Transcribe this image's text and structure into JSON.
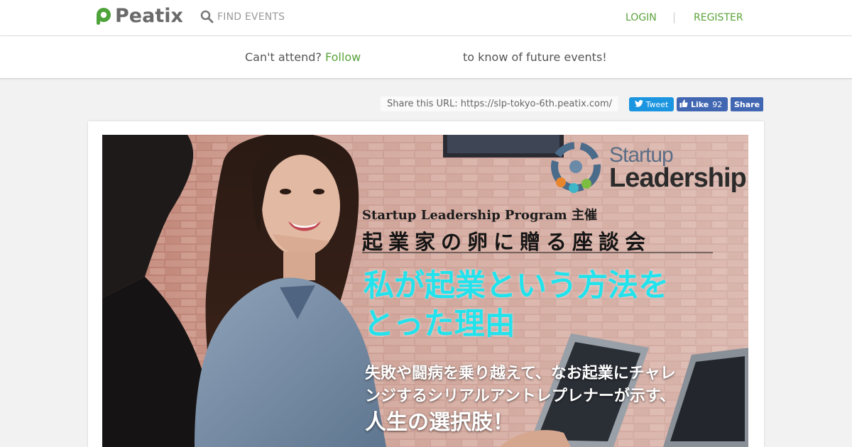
{
  "header": {
    "logo_text": "Peatix",
    "find_label": "FIND EVENTS",
    "login_label": "LOGIN",
    "separator": "|",
    "register_label": "REGISTER"
  },
  "follow_bar": {
    "prefix": "Can't attend?",
    "follow_label": "Follow",
    "suffix": "to know of future events!"
  },
  "share": {
    "url_text": "Share this URL: https://slp-tokyo-6th.peatix.com/",
    "tweet_label": "Tweet",
    "like_label": "Like",
    "like_count": "92",
    "share_label": "Share"
  },
  "banner": {
    "logo_line1": "Startup",
    "logo_line2": "Leadership",
    "program_line": "Startup Leadership Program 主催",
    "event_title": "起業家の卵に贈る座談会",
    "headline_line1": "私が起業という方法を",
    "headline_line2": "とった理由",
    "sub_line1": "失敗や闘病を乗り越えて、なお起業にチャレ",
    "sub_line2": "ンジするシリアルアントレプレナーが示す、",
    "sub_line3": "人生の選択肢！"
  },
  "colors": {
    "brand_green": "#5aa33a",
    "twitter_blue": "#1b95e0",
    "facebook_blue": "#4267b2",
    "headline_cyan": "#22e2ec",
    "page_bg": "#f2f2f2"
  },
  "icons": {
    "logo": "peatix-logo-icon",
    "search": "search-icon",
    "twitter": "twitter-bird-icon",
    "like": "thumbs-up-icon"
  }
}
